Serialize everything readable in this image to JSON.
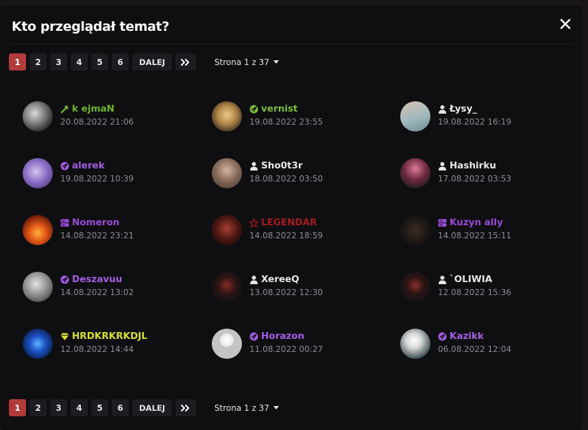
{
  "modal": {
    "title": "Kto przeglądał temat?"
  },
  "pagination": {
    "pages": [
      "1",
      "2",
      "3",
      "4",
      "5",
      "6"
    ],
    "active_page": "1",
    "next_label": "DALEJ",
    "page_info": "Strona 1 z 37"
  },
  "users": [
    {
      "name": "k ejmaN",
      "date": "20.08.2022 21:06",
      "color": "#6fb52a",
      "icon": "hammer-icon"
    },
    {
      "name": "vernist",
      "date": "19.08.2022 23:55",
      "color": "#7bbf3b",
      "icon": "shield-check-icon"
    },
    {
      "name": "Łysy_",
      "date": "19.08.2022 16:19",
      "color": "#e8e8e8",
      "icon": "user-icon"
    },
    {
      "name": "alerek",
      "date": "19.08.2022 10:39",
      "color": "#a45ee5",
      "icon": "shield-check-icon"
    },
    {
      "name": "Sho0t3r",
      "date": "18.08.2022 03:50",
      "color": "#e8e8e8",
      "icon": "user-icon"
    },
    {
      "name": "Hashirku",
      "date": "17.08.2022 03:53",
      "color": "#e8e8e8",
      "icon": "user-icon"
    },
    {
      "name": "Nomeron",
      "date": "14.08.2022 23:21",
      "color": "#9a49d8",
      "icon": "server-icon"
    },
    {
      "name": "LEGENDAR",
      "date": "14.08.2022 18:59",
      "color": "#a31c1c",
      "icon": "star-icon"
    },
    {
      "name": "Kuzyn ally",
      "date": "14.08.2022 15:11",
      "color": "#9a49d8",
      "icon": "server-icon"
    },
    {
      "name": "Deszavuu",
      "date": "14.08.2022 13:02",
      "color": "#a45ee5",
      "icon": "shield-check-icon"
    },
    {
      "name": "XereeQ",
      "date": "13.08.2022 12:30",
      "color": "#e8e8e8",
      "icon": "user-icon"
    },
    {
      "name": "`OLIWIA",
      "date": "12.08.2022 15:36",
      "color": "#e8e8e8",
      "icon": "user-icon"
    },
    {
      "name": "HRDKRKRKDJL",
      "date": "12.08.2022 14:44",
      "color": "#d8e02a",
      "icon": "diamond-icon"
    },
    {
      "name": "Horazon",
      "date": "11.08.2022 00:27",
      "color": "#a45ee5",
      "icon": "shield-check-icon"
    },
    {
      "name": "Kazikk",
      "date": "06.08.2022 12:04",
      "color": "#a45ee5",
      "icon": "shield-check-icon"
    }
  ]
}
